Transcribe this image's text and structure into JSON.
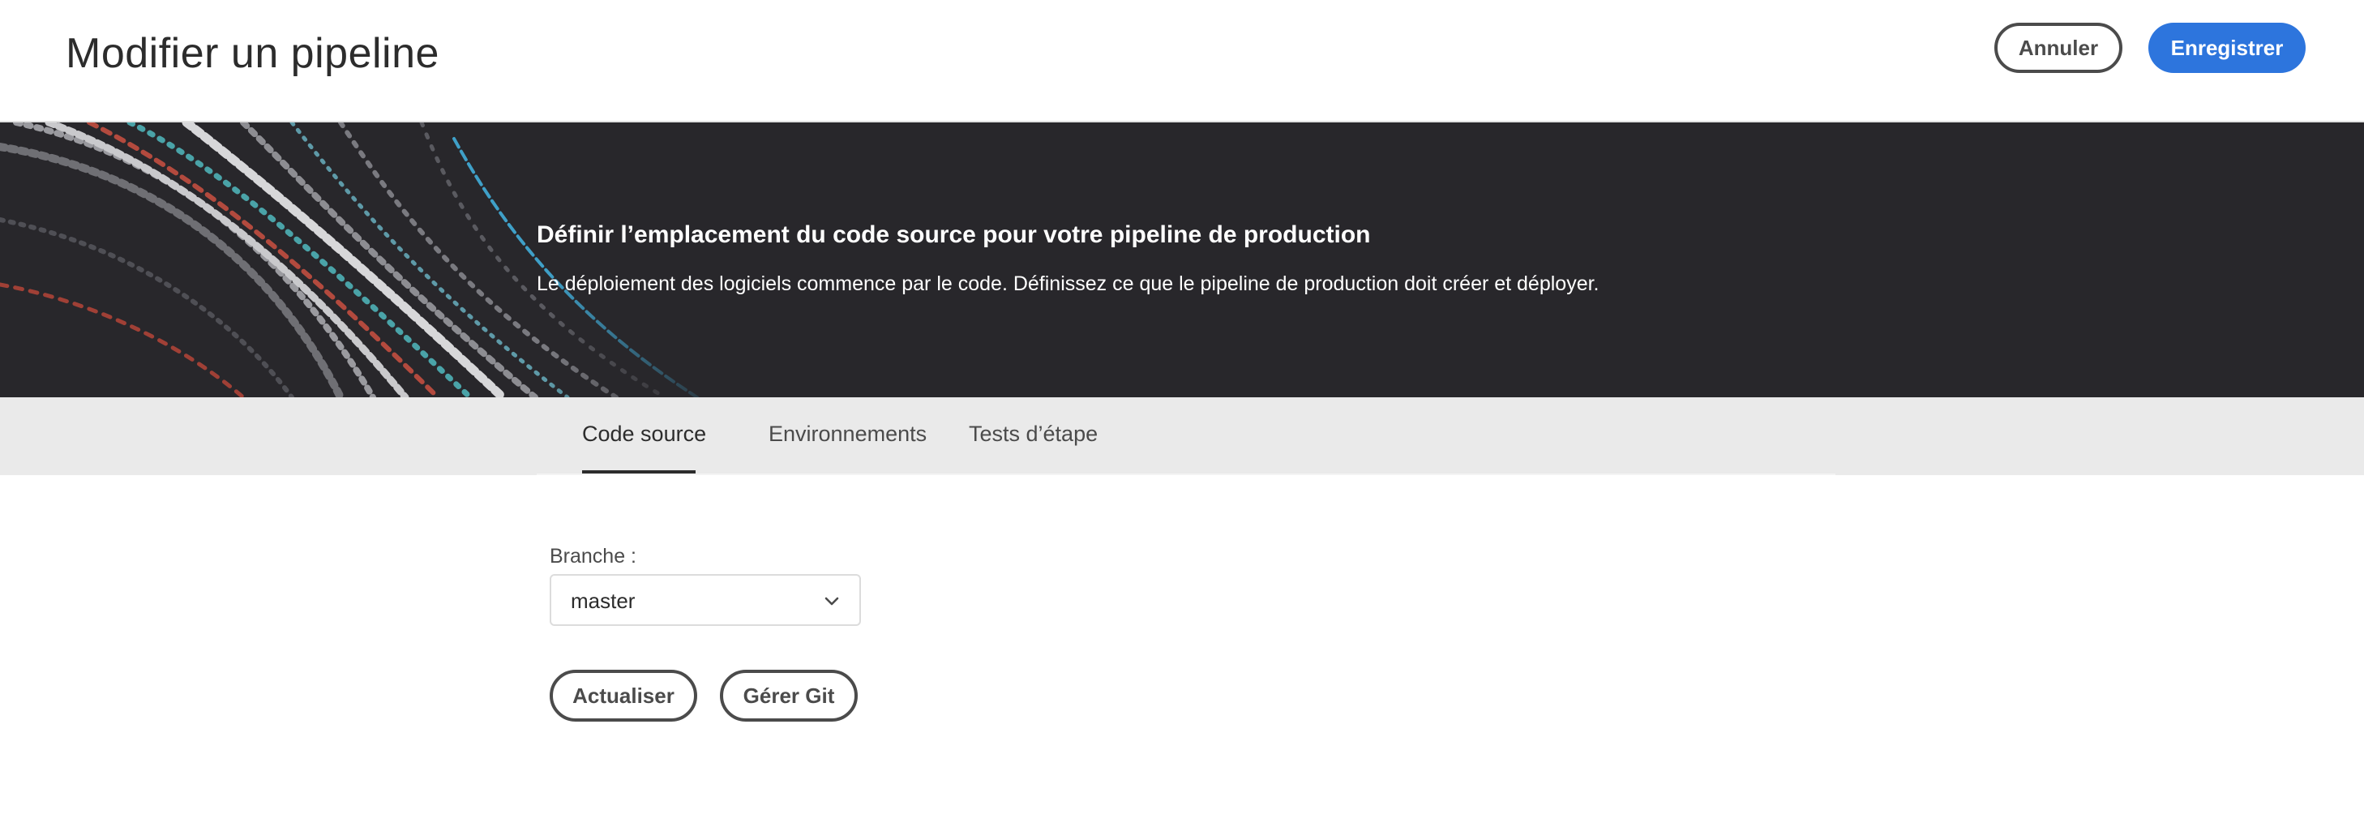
{
  "header": {
    "title": "Modifier un pipeline",
    "cancel_label": "Annuler",
    "save_label": "Enregistrer"
  },
  "banner": {
    "title": "Définir l’emplacement du code source pour votre pipeline de production",
    "subtitle": "Le déploiement des logiciels commence par le code. Définissez ce que le pipeline de production doit créer et déployer."
  },
  "tabs": [
    {
      "label": "Code source",
      "active": true
    },
    {
      "label": "Environnements",
      "active": false
    },
    {
      "label": "Tests d’étape",
      "active": false
    }
  ],
  "form": {
    "branch_label": "Branche :",
    "branch_value": "master",
    "refresh_label": "Actualiser",
    "manage_git_label": "Gérer Git"
  },
  "colors": {
    "primary": "#2d75dd",
    "banner_bg": "#28272b",
    "tabbar_bg": "#eaeaea"
  }
}
